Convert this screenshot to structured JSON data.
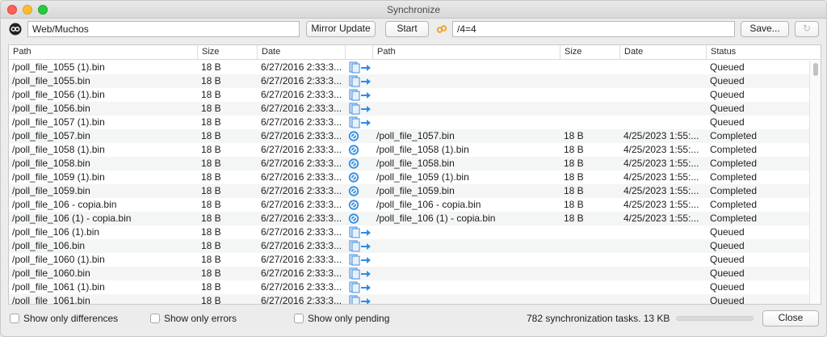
{
  "window": {
    "title": "Synchronize"
  },
  "toolbar": {
    "left_path": "Web/Muchos",
    "mirror_update_label": "Mirror Update",
    "start_label": "Start",
    "right_path": "/4=4",
    "save_label": "Save...",
    "icons": {
      "left": "link-chain-icon",
      "sync": "sync-icon",
      "refresh": "refresh-icon"
    }
  },
  "table": {
    "headers": {
      "left_path": "Path",
      "left_size": "Size",
      "left_date": "Date",
      "right_path": "Path",
      "right_size": "Size",
      "right_date": "Date",
      "status": "Status"
    },
    "rows": [
      {
        "lpath": "/poll_file_1055 (1).bin",
        "lsize": "18 B",
        "ldate": "6/27/2016 2:33:3...",
        "action": "copy",
        "rpath": "",
        "rsize": "",
        "rdate": "",
        "status": "Queued"
      },
      {
        "lpath": "/poll_file_1055.bin",
        "lsize": "18 B",
        "ldate": "6/27/2016 2:33:3...",
        "action": "copy",
        "rpath": "",
        "rsize": "",
        "rdate": "",
        "status": "Queued"
      },
      {
        "lpath": "/poll_file_1056 (1).bin",
        "lsize": "18 B",
        "ldate": "6/27/2016 2:33:3...",
        "action": "copy",
        "rpath": "",
        "rsize": "",
        "rdate": "",
        "status": "Queued"
      },
      {
        "lpath": "/poll_file_1056.bin",
        "lsize": "18 B",
        "ldate": "6/27/2016 2:33:3...",
        "action": "copy",
        "rpath": "",
        "rsize": "",
        "rdate": "",
        "status": "Queued"
      },
      {
        "lpath": "/poll_file_1057 (1).bin",
        "lsize": "18 B",
        "ldate": "6/27/2016 2:33:3...",
        "action": "copy",
        "rpath": "",
        "rsize": "",
        "rdate": "",
        "status": "Queued"
      },
      {
        "lpath": "/poll_file_1057.bin",
        "lsize": "18 B",
        "ldate": "6/27/2016 2:33:3...",
        "action": "skip",
        "rpath": "/poll_file_1057.bin",
        "rsize": "18 B",
        "rdate": "4/25/2023 1:55:...",
        "status": "Completed"
      },
      {
        "lpath": "/poll_file_1058 (1).bin",
        "lsize": "18 B",
        "ldate": "6/27/2016 2:33:3...",
        "action": "skip",
        "rpath": "/poll_file_1058 (1).bin",
        "rsize": "18 B",
        "rdate": "4/25/2023 1:55:...",
        "status": "Completed"
      },
      {
        "lpath": "/poll_file_1058.bin",
        "lsize": "18 B",
        "ldate": "6/27/2016 2:33:3...",
        "action": "skip",
        "rpath": "/poll_file_1058.bin",
        "rsize": "18 B",
        "rdate": "4/25/2023 1:55:...",
        "status": "Completed"
      },
      {
        "lpath": "/poll_file_1059 (1).bin",
        "lsize": "18 B",
        "ldate": "6/27/2016 2:33:3...",
        "action": "skip",
        "rpath": "/poll_file_1059 (1).bin",
        "rsize": "18 B",
        "rdate": "4/25/2023 1:55:...",
        "status": "Completed"
      },
      {
        "lpath": "/poll_file_1059.bin",
        "lsize": "18 B",
        "ldate": "6/27/2016 2:33:3...",
        "action": "skip",
        "rpath": "/poll_file_1059.bin",
        "rsize": "18 B",
        "rdate": "4/25/2023 1:55:...",
        "status": "Completed"
      },
      {
        "lpath": "/poll_file_106 - copia.bin",
        "lsize": "18 B",
        "ldate": "6/27/2016 2:33:3...",
        "action": "skip",
        "rpath": "/poll_file_106 - copia.bin",
        "rsize": "18 B",
        "rdate": "4/25/2023 1:55:...",
        "status": "Completed"
      },
      {
        "lpath": "/poll_file_106 (1) - copia.bin",
        "lsize": "18 B",
        "ldate": "6/27/2016 2:33:3...",
        "action": "skip",
        "rpath": "/poll_file_106 (1) - copia.bin",
        "rsize": "18 B",
        "rdate": "4/25/2023 1:55:...",
        "status": "Completed"
      },
      {
        "lpath": "/poll_file_106 (1).bin",
        "lsize": "18 B",
        "ldate": "6/27/2016 2:33:3...",
        "action": "copy",
        "rpath": "",
        "rsize": "",
        "rdate": "",
        "status": "Queued"
      },
      {
        "lpath": "/poll_file_106.bin",
        "lsize": "18 B",
        "ldate": "6/27/2016 2:33:3...",
        "action": "copy",
        "rpath": "",
        "rsize": "",
        "rdate": "",
        "status": "Queued"
      },
      {
        "lpath": "/poll_file_1060 (1).bin",
        "lsize": "18 B",
        "ldate": "6/27/2016 2:33:3...",
        "action": "copy",
        "rpath": "",
        "rsize": "",
        "rdate": "",
        "status": "Queued"
      },
      {
        "lpath": "/poll_file_1060.bin",
        "lsize": "18 B",
        "ldate": "6/27/2016 2:33:3...",
        "action": "copy",
        "rpath": "",
        "rsize": "",
        "rdate": "",
        "status": "Queued"
      },
      {
        "lpath": "/poll_file_1061 (1).bin",
        "lsize": "18 B",
        "ldate": "6/27/2016 2:33:3...",
        "action": "copy",
        "rpath": "",
        "rsize": "",
        "rdate": "",
        "status": "Queued"
      },
      {
        "lpath": "/poll_file_1061.bin",
        "lsize": "18 B",
        "ldate": "6/27/2016 2:33:3...",
        "action": "copy",
        "rpath": "",
        "rsize": "",
        "rdate": "",
        "status": "Queued"
      }
    ]
  },
  "footer": {
    "show_only_differences": "Show only differences",
    "show_only_errors": "Show only errors",
    "show_only_pending": "Show only pending",
    "status_text": "782 synchronization tasks. 13 KB",
    "progress": 0,
    "close_label": "Close"
  },
  "colors": {
    "accent_blue": "#2f8de4",
    "sync_orange": "#f0a020"
  }
}
